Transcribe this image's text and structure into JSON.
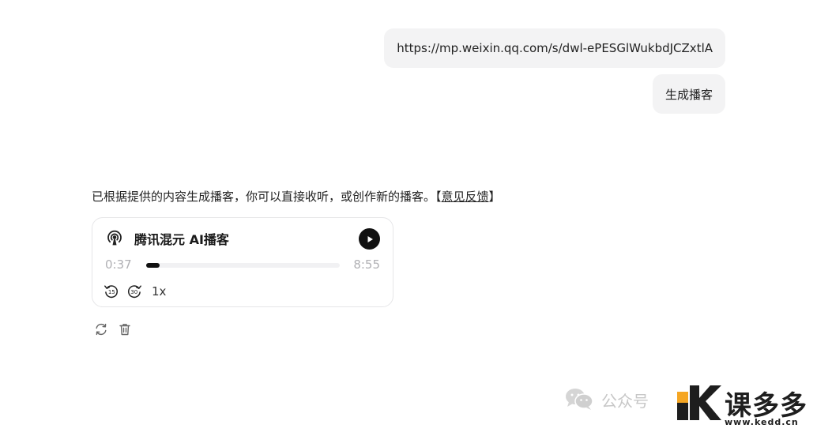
{
  "messages": {
    "user_url": "https://mp.weixin.qq.com/s/dwl-ePESGlWukbdJCZxtlA",
    "user_request": "生成播客"
  },
  "reply": {
    "text": "已根据提供的内容生成播客，你可以直接收听，或创作新的播客。【",
    "feedback_link": "意见反馈",
    "text_end": "】"
  },
  "player": {
    "title": "腾讯混元 AI播客",
    "current_time": "0:37",
    "total_time": "8:55",
    "progress_fraction": 0.069,
    "skip_back_seconds": "15",
    "skip_forward_seconds": "30",
    "speed": "1x",
    "icons": {
      "podcast": "podcast-icon",
      "play": "play-icon",
      "skip_back": "skip-back-15-icon",
      "skip_forward": "skip-forward-30-icon"
    }
  },
  "actions": {
    "regenerate_icon": "refresh-icon",
    "delete_icon": "trash-icon"
  },
  "watermark": {
    "label": "公众号",
    "logo_name": "课多多",
    "logo_url": "www.kedd.cn",
    "accent_color": "#f5a623"
  }
}
